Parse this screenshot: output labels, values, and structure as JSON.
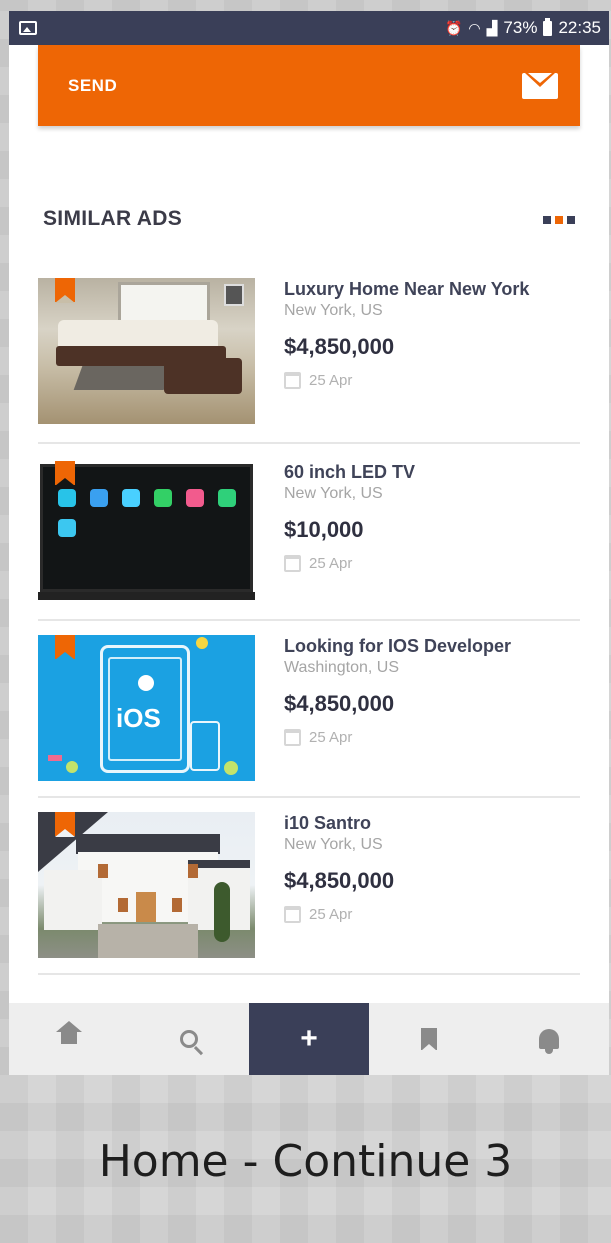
{
  "status_bar": {
    "battery": "73%",
    "time": "22:35"
  },
  "send_button": {
    "label": "SEND",
    "icon": "envelope-icon"
  },
  "similar_ads": {
    "title": "SIMILAR ADS",
    "dots_colors": [
      "#3a3f58",
      "#ee6605",
      "#3a3f58"
    ],
    "items": [
      {
        "title": "Luxury Home Near New York",
        "location": "New York, US",
        "price": "$4,850,000",
        "date": "25 Apr",
        "image": "living-room"
      },
      {
        "title": "60 inch LED TV",
        "location": "New York, US",
        "price": "$10,000",
        "date": "25 Apr",
        "image": "led-tv"
      },
      {
        "title": "Looking for IOS Developer",
        "location": "Washington, US",
        "price": "$4,850,000",
        "date": "25 Apr",
        "image": "ios-developer",
        "image_text": "iOS"
      },
      {
        "title": "i10 Santro",
        "location": "New York, US",
        "price": "$4,850,000",
        "date": "25 Apr",
        "image": "house"
      }
    ]
  },
  "bottom_nav": {
    "items": [
      {
        "icon": "home-icon"
      },
      {
        "icon": "search-icon"
      },
      {
        "icon": "plus-icon",
        "label": "+",
        "active": true
      },
      {
        "icon": "bookmark-icon"
      },
      {
        "icon": "bell-icon"
      }
    ]
  },
  "caption": "Home - Continue 3",
  "colors": {
    "accent": "#ee6605",
    "navy": "#3a3f58",
    "title_text": "#3f4358"
  }
}
